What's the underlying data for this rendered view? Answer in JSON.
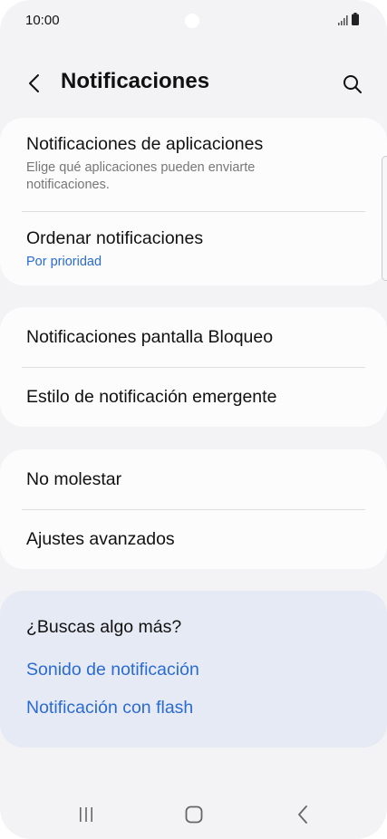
{
  "status_bar": {
    "time": "10:00"
  },
  "header": {
    "title": "Notificaciones",
    "back_icon": "chevron-left-icon",
    "search_icon": "search-icon"
  },
  "sections": {
    "app_notifications": {
      "title": "Notificaciones de aplicaciones",
      "subtitle": "Elige qué aplicaciones pueden enviarte notificaciones."
    },
    "order_notifications": {
      "title": "Ordenar notificaciones",
      "value": "Por prioridad"
    },
    "lock_screen": {
      "title": "Notificaciones pantalla Bloqueo"
    },
    "popup_style": {
      "title": "Estilo de notificación emergente"
    },
    "do_not_disturb": {
      "title": "No molestar"
    },
    "advanced": {
      "title": "Ajustes avanzados"
    }
  },
  "suggestions": {
    "title": "¿Buscas algo más?",
    "links": [
      "Sonido de notificación",
      "Notificación con flash"
    ]
  },
  "nav_bar": {
    "icons": [
      "recent-apps-icon",
      "home-icon",
      "back-icon"
    ]
  },
  "colors": {
    "accent": "#2a6bd1",
    "background": "#f3f3f6",
    "card": "#fcfcfd",
    "suggestion_card": "#e6eaf5"
  }
}
